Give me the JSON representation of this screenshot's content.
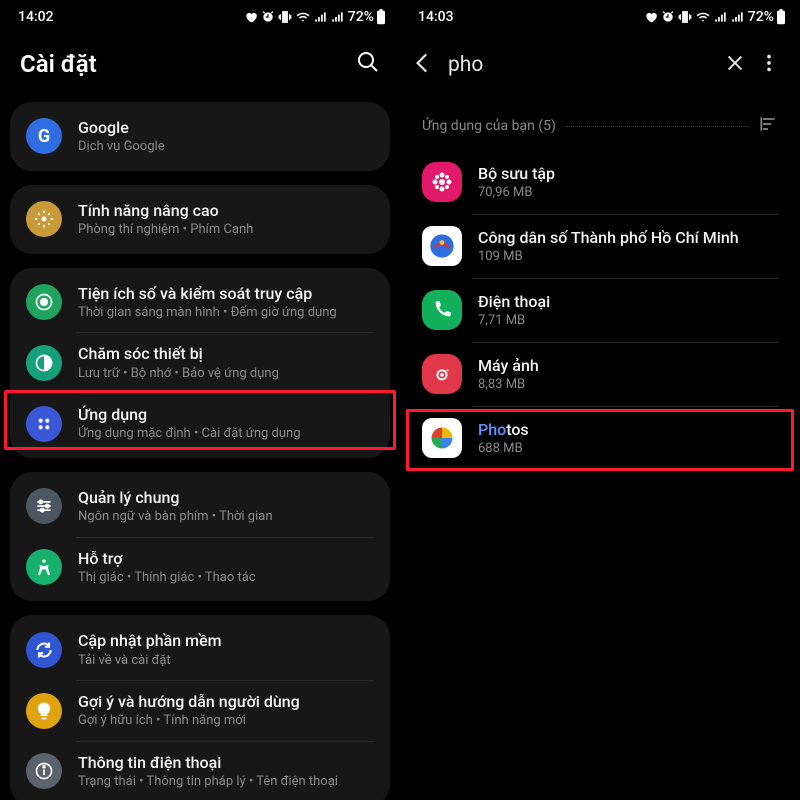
{
  "left": {
    "status": {
      "time": "14:02",
      "battery": "72%"
    },
    "title": "Cài đặt",
    "groups": [
      [
        {
          "id": "google",
          "label": "Google",
          "sublabel": "Dịch vụ Google",
          "iconBg": "#2f6de0",
          "icon": "google"
        }
      ],
      [
        {
          "id": "advanced",
          "label": "Tính năng nâng cao",
          "sublabel": "Phòng thí nghiệm  •  Phím Cạnh",
          "iconBg": "#c99a3a",
          "icon": "advanced"
        }
      ],
      [
        {
          "id": "wellbeing",
          "label": "Tiện ích số và kiểm soát truy cập",
          "sublabel": "Thời gian sáng màn hình  •  Đếm giờ ứng dụng",
          "iconBg": "#1fa35e",
          "icon": "wellbeing"
        },
        {
          "id": "devicecare",
          "label": "Chăm sóc thiết bị",
          "sublabel": "Lưu trữ  •  Bộ nhớ  •  Bảo vệ ứng dụng",
          "iconBg": "#15a07a",
          "icon": "devicecare"
        },
        {
          "id": "apps",
          "label": "Ứng dụng",
          "sublabel": "Ứng dụng mặc định  •  Cài đặt ứng dụng",
          "iconBg": "#3a57d6",
          "icon": "apps",
          "highlighted": true
        }
      ],
      [
        {
          "id": "general",
          "label": "Quản lý chung",
          "sublabel": "Ngôn ngữ và bàn phím  •  Thời gian",
          "iconBg": "#4a5760",
          "icon": "general"
        },
        {
          "id": "accessibility",
          "label": "Hỗ trợ",
          "sublabel": "Thị giác  •  Thính giác  •  Thao tác",
          "iconBg": "#17b06d",
          "icon": "accessibility"
        }
      ],
      [
        {
          "id": "update",
          "label": "Cập nhật phần mềm",
          "sublabel": "Tải về và cài đặt",
          "iconBg": "#2f55d0",
          "icon": "update"
        },
        {
          "id": "tips",
          "label": "Gợi ý và hướng dẫn người dùng",
          "sublabel": "Gợi ý hữu ích  •  Tính năng mới",
          "iconBg": "#e0a310",
          "icon": "tips"
        },
        {
          "id": "about",
          "label": "Thông tin điện thoại",
          "sublabel": "Trạng thái  •  Thông tin pháp lý  •  Tên điện thoại",
          "iconBg": "#5a636b",
          "icon": "about"
        }
      ]
    ]
  },
  "right": {
    "status": {
      "time": "14:03",
      "battery": "72%"
    },
    "search_query": "pho",
    "section_title": "Ứng dụng của bạn (5)",
    "apps": [
      {
        "id": "gallery",
        "label": "Bộ sưu tập",
        "sublabel": "70,96 MB",
        "iconBg": "#e2186a",
        "icon": "gallery"
      },
      {
        "id": "hcmc",
        "label": "Công dân số Thành phố Hồ Chí Minh",
        "sublabel": "109 MB",
        "iconBg": "#ffffff",
        "icon": "hcmc"
      },
      {
        "id": "phone",
        "label": "Điện thoại",
        "sublabel": "7,71 MB",
        "iconBg": "#12b05a",
        "icon": "phone"
      },
      {
        "id": "camera",
        "label": "Máy ảnh",
        "sublabel": "8,83 MB",
        "iconBg": "#e03848",
        "icon": "camera"
      },
      {
        "id": "photos",
        "label_match": "Pho",
        "label_rest": "tos",
        "sublabel": "688 MB",
        "iconBg": "#ffffff",
        "icon": "photos",
        "highlighted": true
      }
    ]
  }
}
